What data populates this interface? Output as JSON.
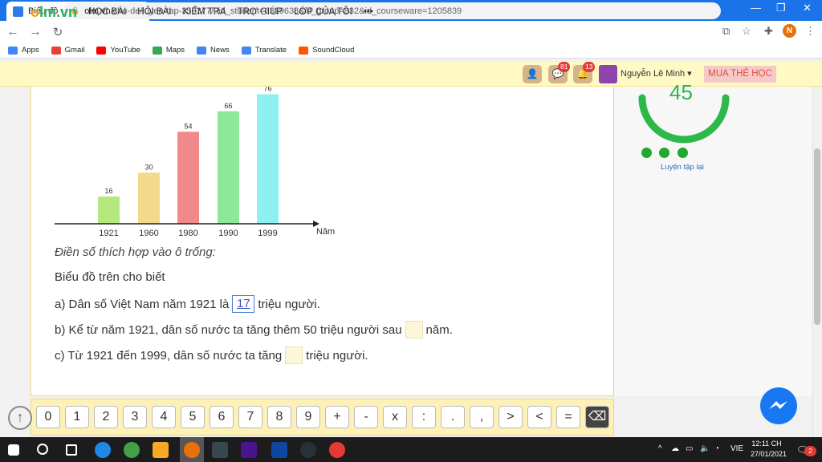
{
  "browser": {
    "tab_title": "Biểu đồ - Học trực tuyến OLM",
    "tab_close": "✕",
    "new_tab": "+",
    "url_host": "olm.vn",
    "url_path": "/chu-de/luyen-tap-350377/?id_student=6319638&id_group=832&id_courseware=1205839",
    "profile_initial": "N",
    "bookmarks": [
      {
        "label": "Apps",
        "color": "#4285f4"
      },
      {
        "label": "Gmail",
        "color": "#ea4335"
      },
      {
        "label": "YouTube",
        "color": "#ff0000"
      },
      {
        "label": "Maps",
        "color": "#34a853"
      },
      {
        "label": "News",
        "color": "#4285f4"
      },
      {
        "label": "Translate",
        "color": "#4285f4"
      },
      {
        "label": "SoundCloud",
        "color": "#ff5500"
      }
    ]
  },
  "header": {
    "logo_o": "o",
    "logo_rest": "lm.vn",
    "nav": [
      "HỌC BÀI",
      "HỎI BÀI",
      "KIỂM TRA",
      "TRỢ GIÚP",
      "LỚP CỦA TÔI",
      "•••"
    ],
    "badge_messages": "81",
    "badge_notifications": "13",
    "username": "Nguyễn Lê Minh ▾",
    "buy_label": "MUA THẺ HỌC"
  },
  "chart_data": {
    "type": "bar",
    "categories": [
      "1921",
      "1960",
      "1980",
      "1990",
      "1999"
    ],
    "values": [
      16,
      30,
      54,
      66,
      76
    ],
    "colors": [
      "#b6e880",
      "#f3d98b",
      "#f08a8a",
      "#8ee89a",
      "#8ef0f0"
    ],
    "xlabel": "Năm",
    "ylim": [
      0,
      80
    ]
  },
  "question": {
    "instruction": "Điền số thích hợp vào ô trống:",
    "intro": "Biểu đồ trên cho biết",
    "a_before": "a) Dân số Việt Nam năm 1921 là",
    "a_value": "17",
    "a_after": "triệu người.",
    "b_before": "b) Kể từ năm 1921, dân số nước ta tăng thêm 50 triệu người sau",
    "b_after": "năm.",
    "c_before": "c) Từ 1921 đến 1999, dân số nước ta tăng",
    "c_after": "triệu người."
  },
  "score": {
    "value": "45",
    "ring_color": "#2db84a",
    "retry_label": "Luyện tập lại"
  },
  "keypad": [
    "0",
    "1",
    "2",
    "3",
    "4",
    "5",
    "6",
    "7",
    "8",
    "9",
    "+",
    "-",
    "x",
    ":",
    ".",
    ",",
    ">",
    "<",
    "=",
    "⌫"
  ],
  "taskbar": {
    "ime": "VIE",
    "time": "12:11 CH",
    "date": "27/01/2021",
    "notif_count": "2"
  }
}
